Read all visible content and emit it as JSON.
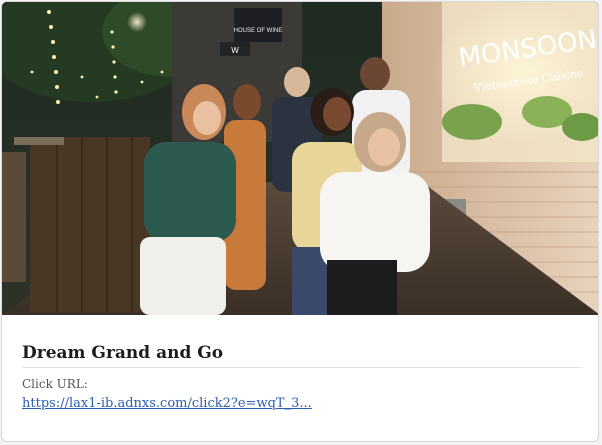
{
  "card": {
    "image_alt": "Group of friends laughing on a city sidewalk at night",
    "signs": {
      "restaurant": "MONSOON",
      "restaurant_sub": "Vietnamese Cuisine",
      "shop_top": "HOUSE OF WINE",
      "shop_bottom": "W"
    },
    "title": "Dream Grand and Go",
    "click_label": "Click URL:",
    "click_url": "https://lax1-ib.adnxs.com/click2?e=wqT_3..."
  }
}
